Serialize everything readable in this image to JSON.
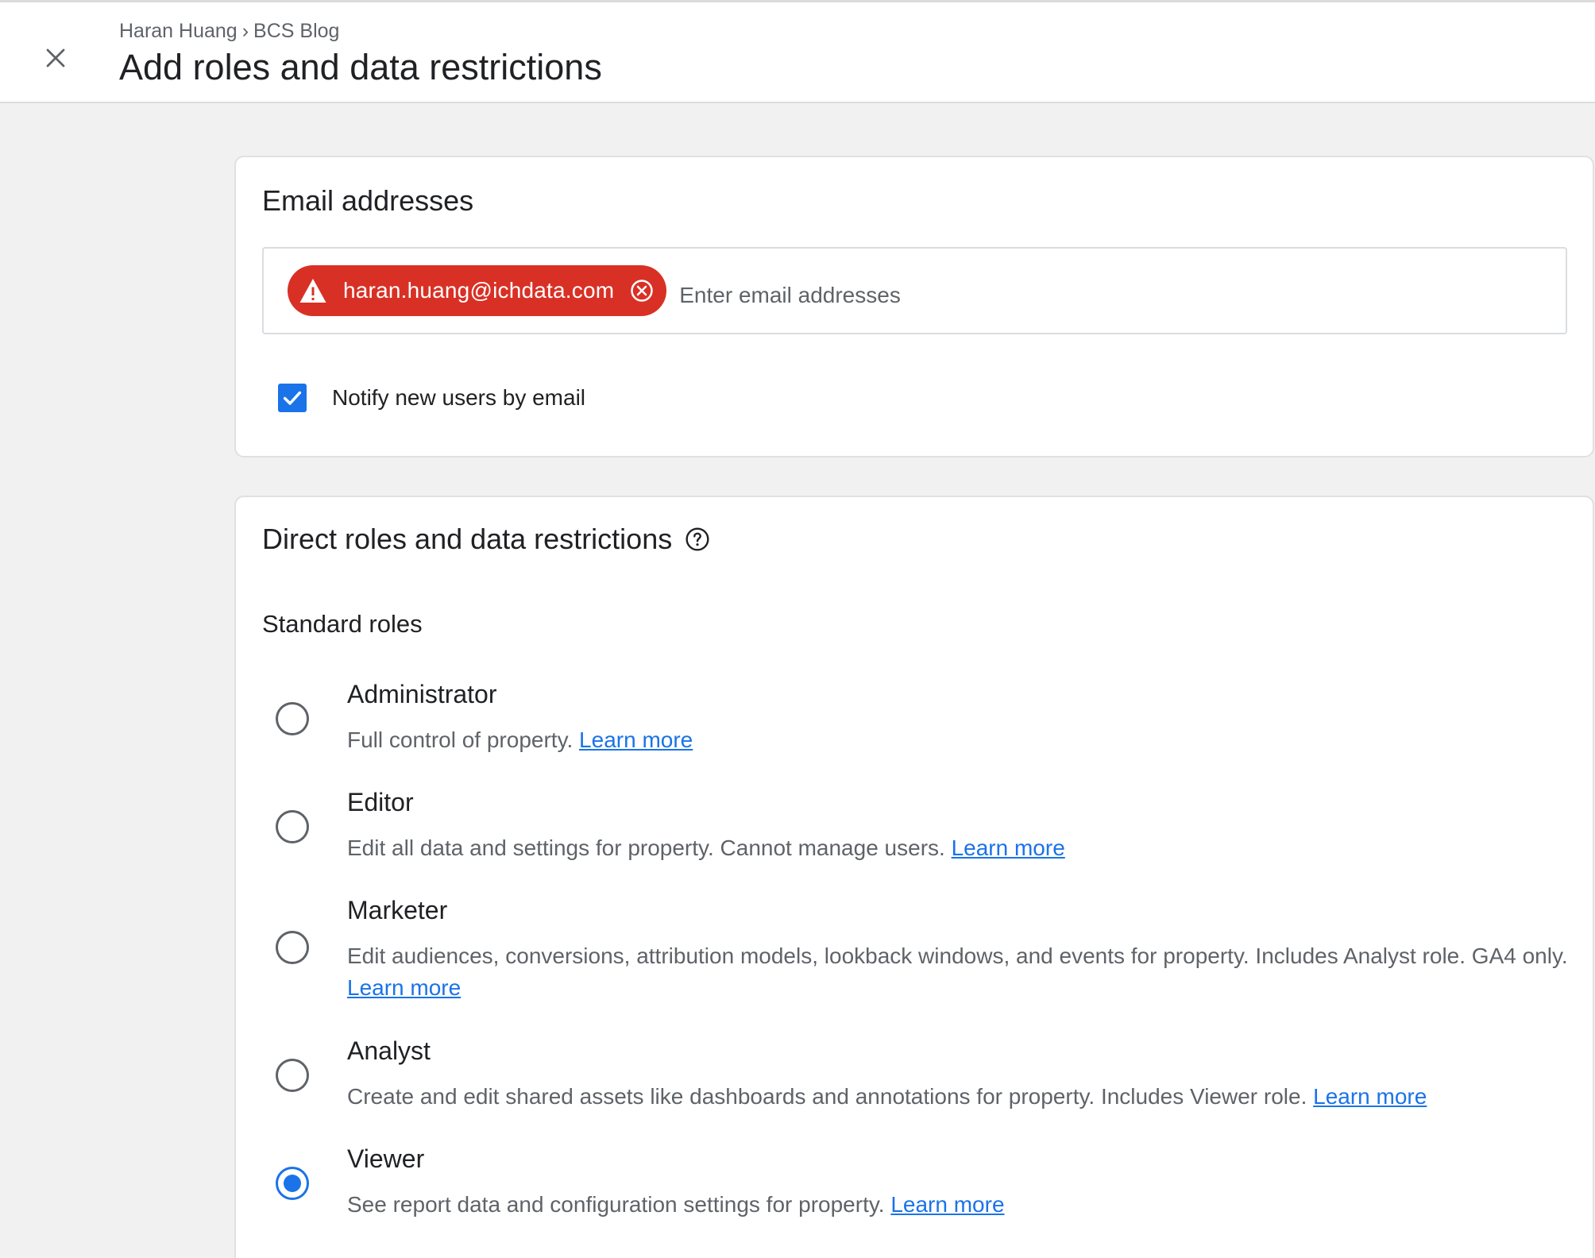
{
  "header": {
    "breadcrumb": {
      "account": "Haran Huang",
      "separator": "›",
      "property": "BCS Blog"
    },
    "title": "Add roles and data restrictions"
  },
  "email_card": {
    "title": "Email addresses",
    "chip_email": "haran.huang@ichdata.com",
    "chip_status": "error",
    "input_placeholder": "Enter email addresses",
    "input_value": "",
    "notify_label": "Notify new users by email",
    "notify_checked": true
  },
  "roles_card": {
    "title": "Direct roles and data restrictions",
    "section_label": "Standard roles",
    "selected_role": "Viewer",
    "roles": [
      {
        "name": "Administrator",
        "desc": "Full control of property.",
        "link": "Learn more"
      },
      {
        "name": "Editor",
        "desc": "Edit all data and settings for property. Cannot manage users.",
        "link": "Learn more"
      },
      {
        "name": "Marketer",
        "desc": "Edit audiences, conversions, attribution models, lookback windows, and events for property. Includes Analyst role. GA4 only.",
        "link": "Learn more"
      },
      {
        "name": "Analyst",
        "desc": "Create and edit shared assets like dashboards and annotations for property. Includes Viewer role.",
        "link": "Learn more"
      },
      {
        "name": "Viewer",
        "desc": "See report data and configuration settings for property.",
        "link": "Learn more"
      }
    ]
  },
  "colors": {
    "accent": "#1a73e8",
    "error": "#d93025",
    "background": "#f1f1f1"
  },
  "icons": [
    "close-icon",
    "warning-icon",
    "cancel-icon",
    "check-icon",
    "help-icon"
  ]
}
